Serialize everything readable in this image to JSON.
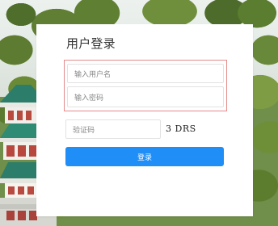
{
  "title": "用户登录",
  "username": {
    "placeholder": "输入用户名"
  },
  "password": {
    "placeholder": "输入密码"
  },
  "captcha": {
    "placeholder": "验证码",
    "code": "3 DRS"
  },
  "login": {
    "label": "登录"
  },
  "colors": {
    "accent": "#1f8ef6",
    "highlight_border": "#e48a8a"
  },
  "icons": {
    "background": "pagoda-and-trees-scene"
  }
}
